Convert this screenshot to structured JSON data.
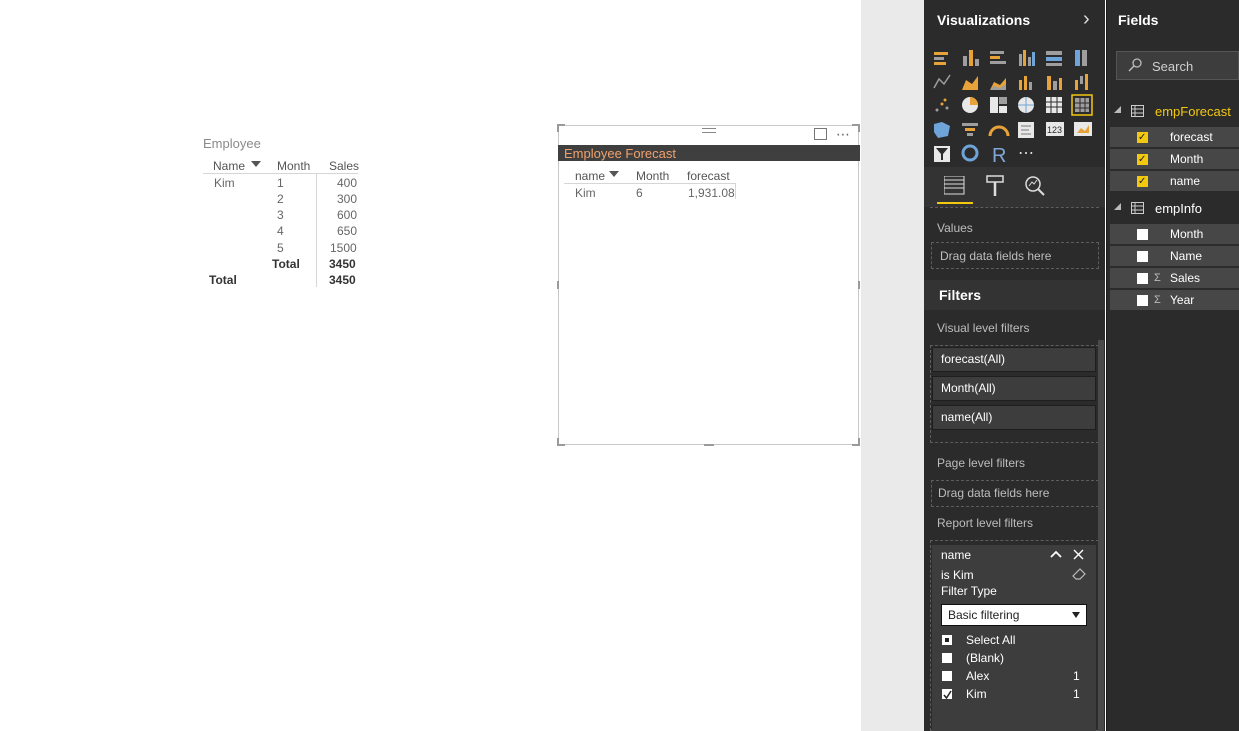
{
  "report": {
    "employee_table": {
      "title": "Employee",
      "headers": [
        "Name",
        "Month",
        "Sales"
      ],
      "rows": [
        {
          "name": "Kim",
          "month": "1",
          "sales": "400"
        },
        {
          "name": "",
          "month": "2",
          "sales": "300"
        },
        {
          "name": "",
          "month": "3",
          "sales": "600"
        },
        {
          "name": "",
          "month": "4",
          "sales": "650"
        },
        {
          "name": "",
          "month": "5",
          "sales": "1500"
        }
      ],
      "subtotal_label": "Total",
      "subtotal_value": "3450",
      "total_label": "Total",
      "total_value": "3450"
    },
    "forecast_visual": {
      "title": "Employee Forecast",
      "headers": [
        "name",
        "Month",
        "forecast"
      ],
      "row": {
        "name": "Kim",
        "month": "6",
        "forecast": "1,931.08"
      },
      "more_label": "⋯"
    }
  },
  "visualizations": {
    "title": "Visualizations",
    "expand_glyph": "›",
    "more_label": "⋯",
    "r_label": "R",
    "number_label": "123",
    "values_label": "Values",
    "values_drop": "Drag data fields here"
  },
  "filters": {
    "title": "Filters",
    "visual_level_label": "Visual level filters",
    "visual_level": [
      "forecast(All)",
      "Month(All)",
      "name(All)"
    ],
    "page_level_label": "Page level filters",
    "page_level_drop": "Drag data fields here",
    "report_level_label": "Report level filters",
    "report_filter": {
      "field": "name",
      "condition": "is Kim",
      "filter_type_label": "Filter Type",
      "filter_type_value": "Basic filtering",
      "options": [
        {
          "label": "Select All",
          "count": ""
        },
        {
          "label": "(Blank)",
          "count": ""
        },
        {
          "label": "Alex",
          "count": "1"
        },
        {
          "label": "Kim",
          "count": "1"
        }
      ]
    }
  },
  "fields": {
    "title": "Fields",
    "search_placeholder": "Search",
    "tables": [
      {
        "name": "empForecast",
        "fields": [
          {
            "label": "forecast",
            "checked": true
          },
          {
            "label": "Month",
            "checked": true
          },
          {
            "label": "name",
            "checked": true
          }
        ]
      },
      {
        "name": "empInfo",
        "fields": [
          {
            "label": "Month",
            "checked": false
          },
          {
            "label": "Name",
            "checked": false
          },
          {
            "label": "Sales",
            "checked": false
          },
          {
            "label": "Year",
            "checked": false
          }
        ]
      }
    ]
  },
  "colors": {
    "accent": "#f2c811",
    "forecast_title": "#f2a16c",
    "pane_bg": "#2b2b2b"
  }
}
